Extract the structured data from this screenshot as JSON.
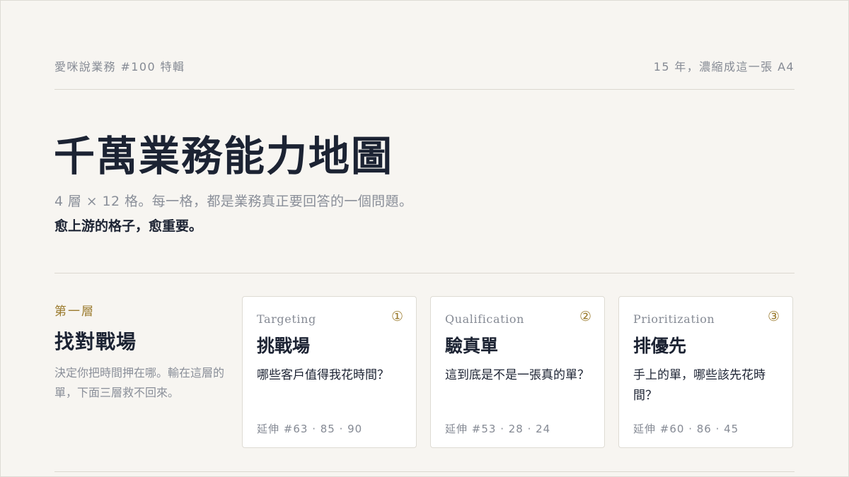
{
  "header": {
    "series_label": "愛咪說業務 #100 特輯",
    "tagline": "15 年，濃縮成這一張 A4"
  },
  "title": "千萬業務能力地圖",
  "subtitle": "4 層 × 12 格。每一格，都是業務真正要回答的一個問題。",
  "emphasis": "愈上游的格子，愈重要。",
  "layer": {
    "tag": "第一層",
    "name": "找對戰場",
    "description": "決定你把時間押在哪。輸在這層的單，下面三層救不回來。"
  },
  "cards": [
    {
      "en": "Targeting",
      "number": "①",
      "zh": "挑戰場",
      "question": "哪些客戶值得我花時間？",
      "extension": "延伸 #63 · 85 · 90"
    },
    {
      "en": "Qualification",
      "number": "②",
      "zh": "驗真單",
      "question": "這到底是不是一張真的單？",
      "extension": "延伸 #53 · 28 · 24"
    },
    {
      "en": "Prioritization",
      "number": "③",
      "zh": "排優先",
      "question": "手上的單，哪些該先花時間？",
      "extension": "延伸 #60 · 86 · 45"
    }
  ],
  "colors": {
    "background": "#f7f5f1",
    "accent_gold": "#9b7b2e",
    "text_dark": "#1c2333",
    "text_muted": "#8a8f99"
  }
}
